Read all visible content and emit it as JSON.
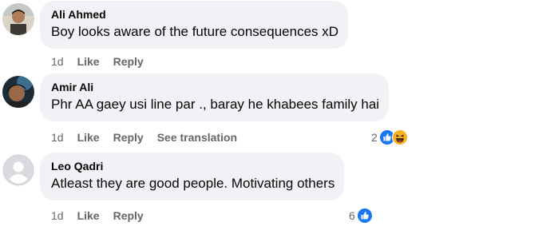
{
  "comments": [
    {
      "author": "Ali Ahmed",
      "text": "Boy looks aware of the future consequences xD",
      "time": "1d",
      "like_label": "Like",
      "reply_label": "Reply"
    },
    {
      "author": "Amir Ali",
      "text": "Phr AA gaey usi line par ., baray he khabees family hai",
      "time": "1d",
      "like_label": "Like",
      "reply_label": "Reply",
      "translate_label": "See translation",
      "reaction_count": "2",
      "reaction_icons": [
        "like-icon",
        "haha-icon"
      ]
    },
    {
      "author": "Leo Qadri",
      "text": "Atleast they are good people. Motivating others",
      "time": "1d",
      "like_label": "Like",
      "reply_label": "Reply",
      "reaction_count": "6",
      "reaction_icons": [
        "like-icon"
      ]
    }
  ],
  "colors": {
    "bubble": "#f0f2f5",
    "meta_text": "#65676b",
    "like_blue": "#1877f2",
    "haha_yellow": "#f7b125"
  }
}
